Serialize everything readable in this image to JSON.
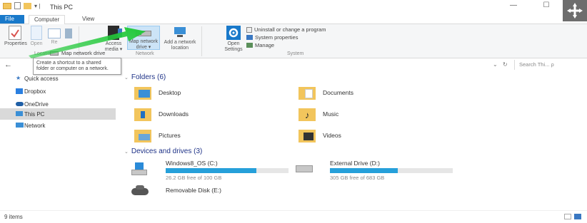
{
  "window": {
    "title": "This PC",
    "title_prefix": "▾ |",
    "minimize": "—",
    "maximize": "☐"
  },
  "ribbon_tabs": [
    {
      "label": "File"
    },
    {
      "label": "Computer"
    },
    {
      "label": "View"
    }
  ],
  "ribbon": {
    "properties": "Properties",
    "open": "Open",
    "rename": "Re",
    "access_media_line1": "Access",
    "access_media_line2": "media ▾",
    "map_network_drive_line1": "Map network",
    "map_network_drive_line2": "drive ▾",
    "add_network_location_line1": "Add a network",
    "add_network_location_line2": "location",
    "open_settings_line1": "Open",
    "open_settings_line2": "Settings",
    "uninstall": "Uninstall or change a program",
    "system_properties": "System properties",
    "manage": "Manage",
    "group_location": "Location",
    "group_network": "Network",
    "group_system": "System"
  },
  "dropdown": {
    "map_network_drive_item": "Map network drive"
  },
  "tooltip": {
    "line1": "Create a shortcut to a shared",
    "line2": "folder or computer on a network."
  },
  "addressbar": {
    "back": "←",
    "dropdown": "⌄",
    "refresh": "↻",
    "search_placeholder": "Search Thi... ρ"
  },
  "nav": {
    "items": [
      {
        "label": "Quick access"
      },
      {
        "label": "Dropbox"
      },
      {
        "label": "OneDrive"
      },
      {
        "label": "This PC"
      },
      {
        "label": "Network"
      }
    ]
  },
  "content": {
    "folders_header": "Folders (6)",
    "folders": [
      {
        "label": "Desktop"
      },
      {
        "label": "Documents"
      },
      {
        "label": "Downloads"
      },
      {
        "label": "Music"
      },
      {
        "label": "Pictures"
      },
      {
        "label": "Videos"
      }
    ],
    "devices_header": "Devices and drives (3)",
    "drives": [
      {
        "label": "Windows8_OS (C:)",
        "free": "26.2 GB free of 100 GB",
        "used_fraction": 0.74
      },
      {
        "label": "External Drive (D:)",
        "free": "305 GB free of 683 GB",
        "used_fraction": 0.55
      },
      {
        "label": "Removable Disk (E:)"
      }
    ]
  },
  "statusbar": {
    "items": "9 items"
  },
  "colors": {
    "accent": "#1979ca",
    "drive_fill": "#26a0da",
    "arrow": "#22c93a",
    "folder_yellow": "#f2c55c",
    "nav_selected": "#d9d9d9"
  }
}
